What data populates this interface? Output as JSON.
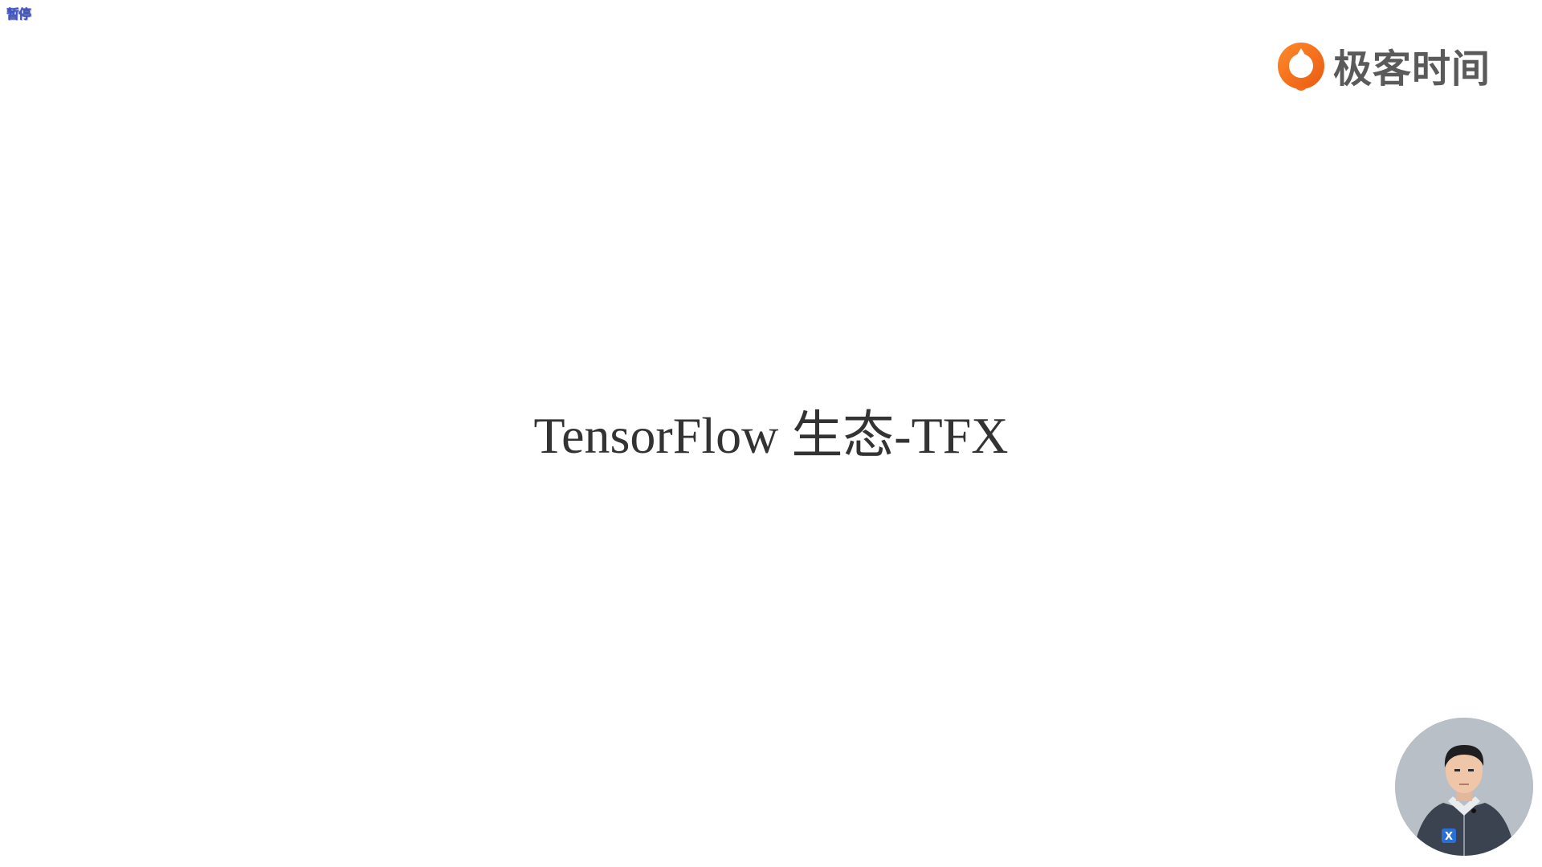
{
  "status": {
    "pause_label": "暂停"
  },
  "brand": {
    "name": "极客时间",
    "accent_color": "#f26b1d",
    "logo_icon": "geektime-logo-icon"
  },
  "slide": {
    "title": "TensorFlow 生态-TFX"
  },
  "presenter": {
    "icon": "presenter-video-avatar",
    "badge_letter": "X"
  }
}
